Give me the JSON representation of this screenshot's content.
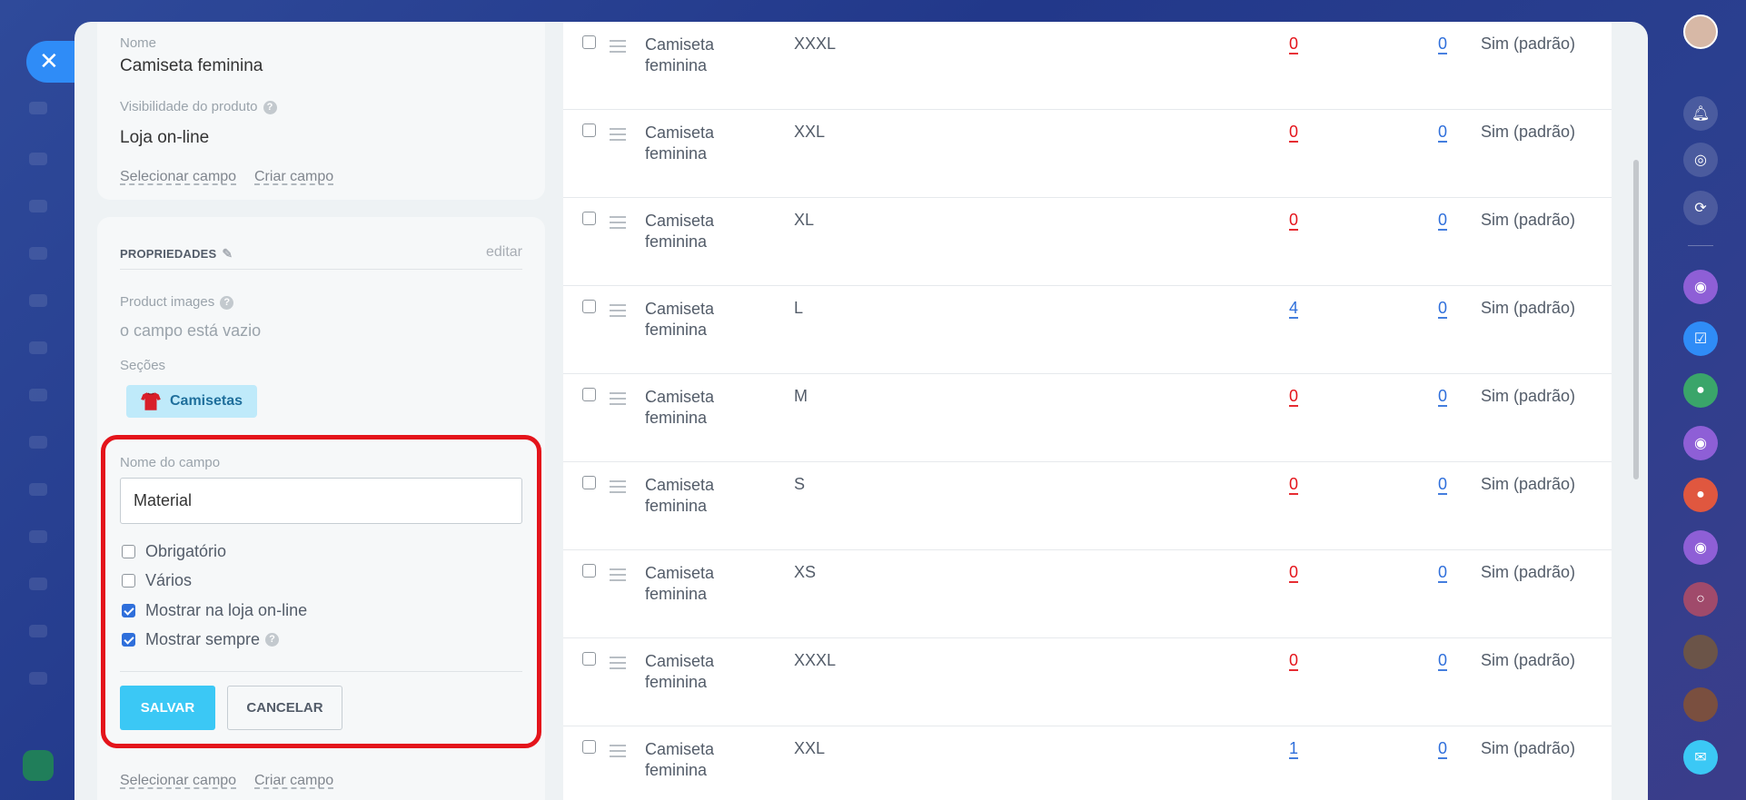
{
  "product": {
    "name_label": "Nome",
    "name_value": "Camiseta feminina",
    "visibility_label": "Visibilidade do produto",
    "visibility_value": "Loja on-line",
    "select_field": "Selecionar campo",
    "create_field": "Criar campo"
  },
  "properties": {
    "title": "PROPRIEDADES",
    "edit_link": "editar",
    "images_label": "Product images",
    "images_empty": "o campo está vazio",
    "sections_label": "Seções",
    "section_tag": "Camisetas",
    "select_field": "Selecionar campo",
    "create_field": "Criar campo"
  },
  "field_editor": {
    "name_label": "Nome do campo",
    "name_value": "Material",
    "options": [
      {
        "label": "Obrigatório",
        "checked": false
      },
      {
        "label": "Vários",
        "checked": false
      },
      {
        "label": "Mostrar na loja on-line",
        "checked": true
      },
      {
        "label": "Mostrar sempre",
        "checked": true
      }
    ],
    "save_label": "SALVAR",
    "cancel_label": "CANCELAR"
  },
  "variants": [
    {
      "name": "Camiseta feminina",
      "size": "XXXL",
      "q1": "0",
      "q1_color": "red",
      "q2": "0",
      "default": "Sim (padrão)"
    },
    {
      "name": "Camiseta feminina",
      "size": "XXL",
      "q1": "0",
      "q1_color": "red",
      "q2": "0",
      "default": "Sim (padrão)"
    },
    {
      "name": "Camiseta feminina",
      "size": "XL",
      "q1": "0",
      "q1_color": "red",
      "q2": "0",
      "default": "Sim (padrão)"
    },
    {
      "name": "Camiseta feminina",
      "size": "L",
      "q1": "4",
      "q1_color": "blue",
      "q2": "0",
      "default": "Sim (padrão)"
    },
    {
      "name": "Camiseta feminina",
      "size": "M",
      "q1": "0",
      "q1_color": "red",
      "q2": "0",
      "default": "Sim (padrão)"
    },
    {
      "name": "Camiseta feminina",
      "size": "S",
      "q1": "0",
      "q1_color": "red",
      "q2": "0",
      "default": "Sim (padrão)"
    },
    {
      "name": "Camiseta feminina",
      "size": "XS",
      "q1": "0",
      "q1_color": "red",
      "q2": "0",
      "default": "Sim (padrão)"
    },
    {
      "name": "Camiseta feminina",
      "size": "XXXL",
      "q1": "0",
      "q1_color": "red",
      "q2": "0",
      "default": "Sim (padrão)"
    },
    {
      "name": "Camiseta feminina",
      "size": "XXL",
      "q1": "1",
      "q1_color": "blue",
      "q2": "0",
      "default": "Sim (padrão)"
    }
  ],
  "colors": {
    "accent": "#3bc8f5",
    "highlight_border": "#e4141b",
    "link_blue": "#2f6fdb",
    "zero_red": "#e4141b"
  },
  "right_panel_icons": [
    "user-avatar",
    "bell-icon",
    "target-icon",
    "sync-icon",
    "open-channel-icon",
    "task-icon",
    "group-icon",
    "open-channel-icon",
    "group-icon",
    "open-channel-icon",
    "circle-icon",
    "user-avatar",
    "user-avatar",
    "chat-icon"
  ]
}
